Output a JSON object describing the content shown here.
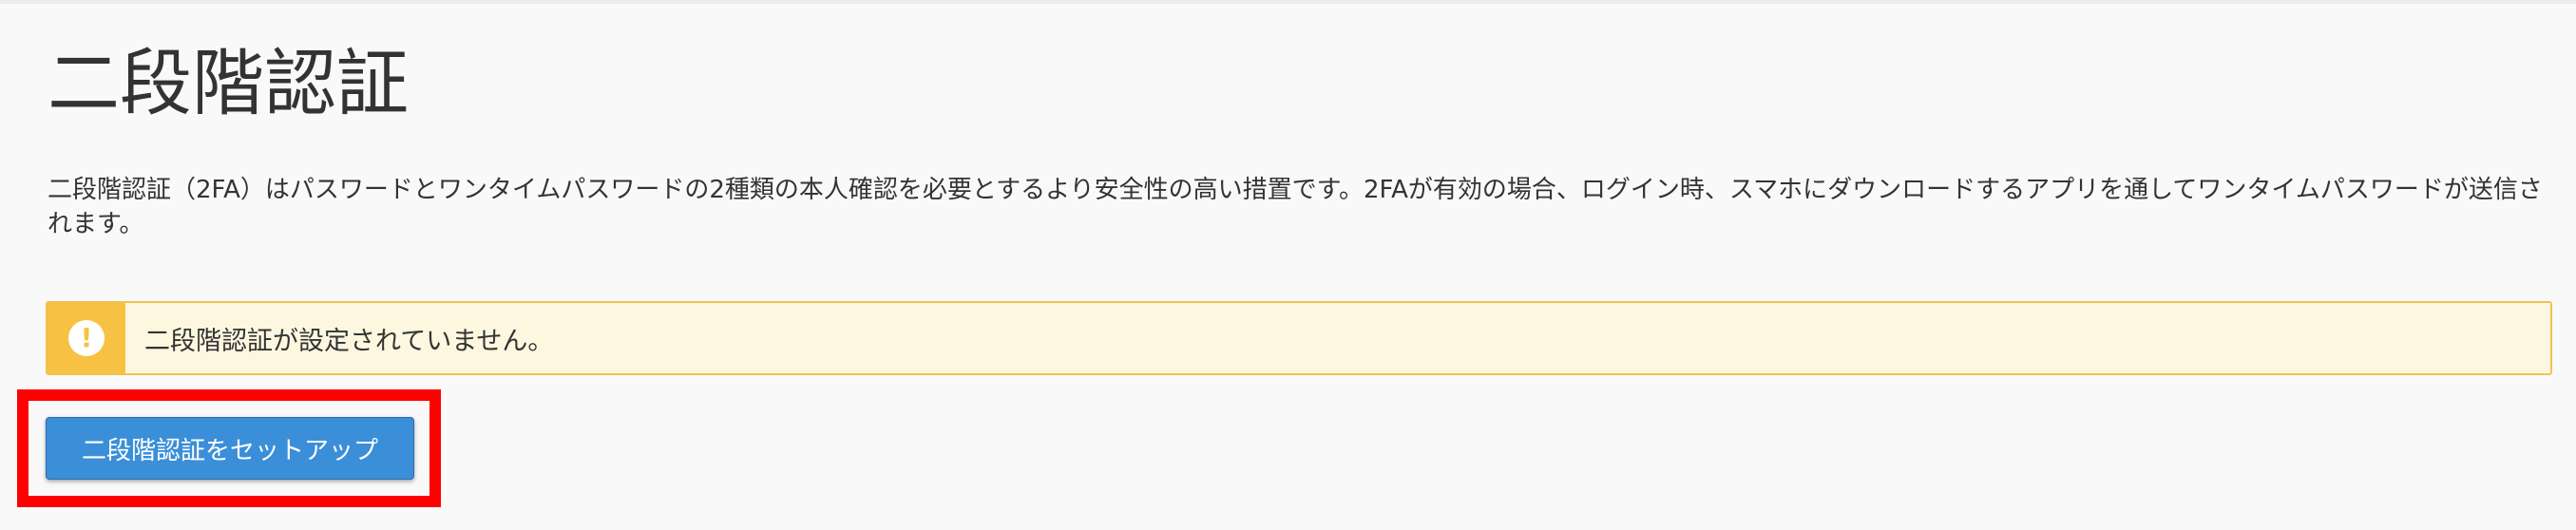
{
  "page": {
    "title": "二段階認証",
    "description": "二段階認証（2FA）はパスワードとワンタイムパスワードの2種類の本人確認を必要とするより安全性の高い措置です。2FAが有効の場合、ログイン時、スマホにダウンロードするアプリを通してワンタイムパスワードが送信されます。"
  },
  "alert": {
    "icon": "exclamation-icon",
    "message": "二段階認証が設定されていません。",
    "colors": {
      "icon_background": "#f7c244",
      "border": "#f2c24f",
      "background": "#fdf7e0"
    }
  },
  "actions": {
    "setup_label": "二段階認証をセットアップ",
    "button_color": "#3a8fd8",
    "highlight_color": "#ff0000"
  }
}
